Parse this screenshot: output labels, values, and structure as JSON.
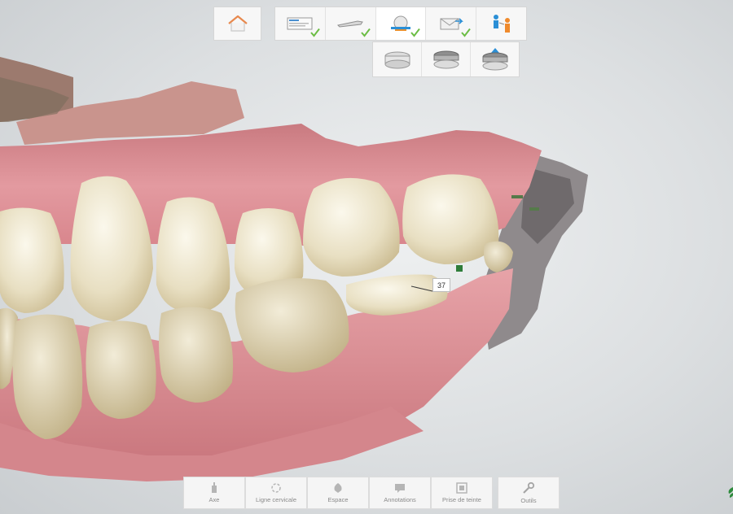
{
  "toolbar_top": {
    "home": {
      "icon": "house-icon"
    },
    "steps": [
      {
        "icon": "prescription-form-icon",
        "done": true
      },
      {
        "icon": "scanner-wand-icon",
        "done": true
      },
      {
        "icon": "model-analysis-icon",
        "done": true,
        "active": true
      },
      {
        "icon": "send-envelope-icon",
        "done": true
      },
      {
        "icon": "lab-transfer-icon",
        "done": false
      }
    ],
    "substeps": [
      {
        "icon": "jaw-model-icon"
      },
      {
        "icon": "occlusion-model-icon"
      },
      {
        "icon": "bite-alignment-icon"
      }
    ]
  },
  "annotation": {
    "tooth_number": "37"
  },
  "tools": [
    {
      "id": "axe",
      "label": "Axe",
      "icon": "axis-icon"
    },
    {
      "id": "ligne",
      "label": "Ligne cervicale",
      "icon": "margin-line-icon"
    },
    {
      "id": "espace",
      "label": "Espace",
      "icon": "spacer-icon"
    },
    {
      "id": "annotations",
      "label": "Annotations",
      "icon": "annotation-icon"
    },
    {
      "id": "teinte",
      "label": "Prise de teinte",
      "icon": "shade-icon"
    },
    {
      "id": "outils",
      "label": "Outils",
      "icon": "wrench-icon"
    }
  ],
  "colors": {
    "check": "#6cbd45",
    "accent": "#2b8fd6",
    "gum": "#d9848a",
    "tooth": "#ece4c8"
  }
}
